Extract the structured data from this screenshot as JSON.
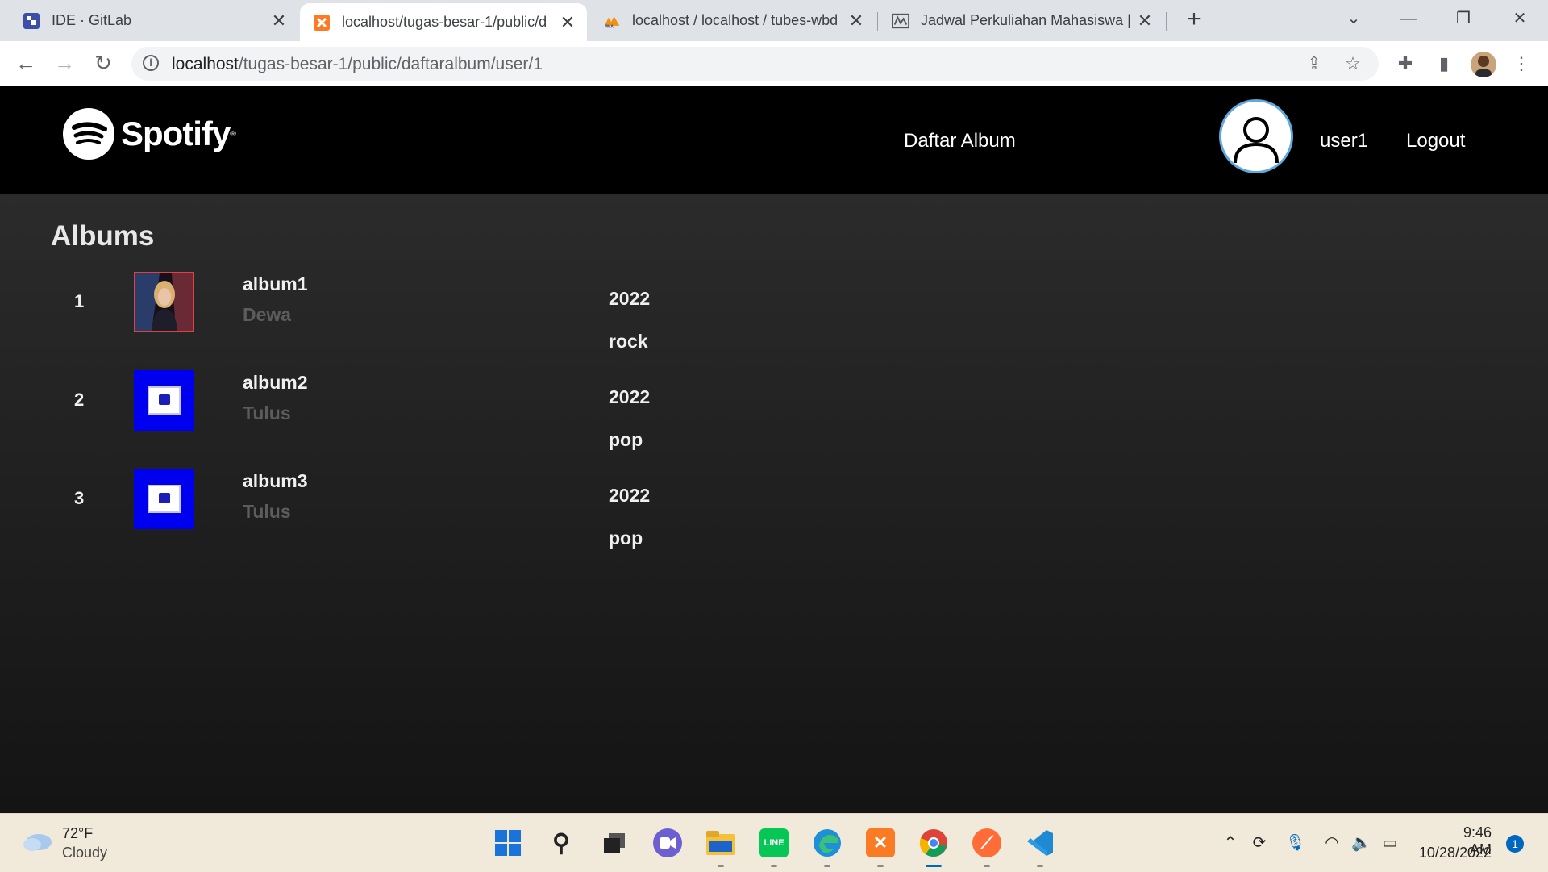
{
  "browser": {
    "tabs": [
      {
        "title": "IDE · GitLab",
        "active": false
      },
      {
        "title": "localhost/tugas-besar-1/public/d",
        "active": true
      },
      {
        "title": "localhost / localhost / tubes-wbd",
        "active": false
      },
      {
        "title": "Jadwal Perkuliahan Mahasiswa | S",
        "active": false
      }
    ],
    "url_host": "localhost",
    "url_path": "/tugas-besar-1/public/daftaralbum/user/1"
  },
  "header": {
    "brand": "Spotify",
    "nav_label": "Daftar Album",
    "username": "user1",
    "logout_label": "Logout"
  },
  "page": {
    "title": "Albums",
    "albums": [
      {
        "number": "1",
        "name": "album1",
        "artist": "Dewa",
        "year": "2022",
        "genre": "rock"
      },
      {
        "number": "2",
        "name": "album2",
        "artist": "Tulus",
        "year": "2022",
        "genre": "pop"
      },
      {
        "number": "3",
        "name": "album3",
        "artist": "Tulus",
        "year": "2022",
        "genre": "pop"
      }
    ]
  },
  "taskbar": {
    "weather_temp": "72°F",
    "weather_condition": "Cloudy",
    "time": "9:46 AM",
    "date": "10/28/2022",
    "notification_count": "1"
  }
}
